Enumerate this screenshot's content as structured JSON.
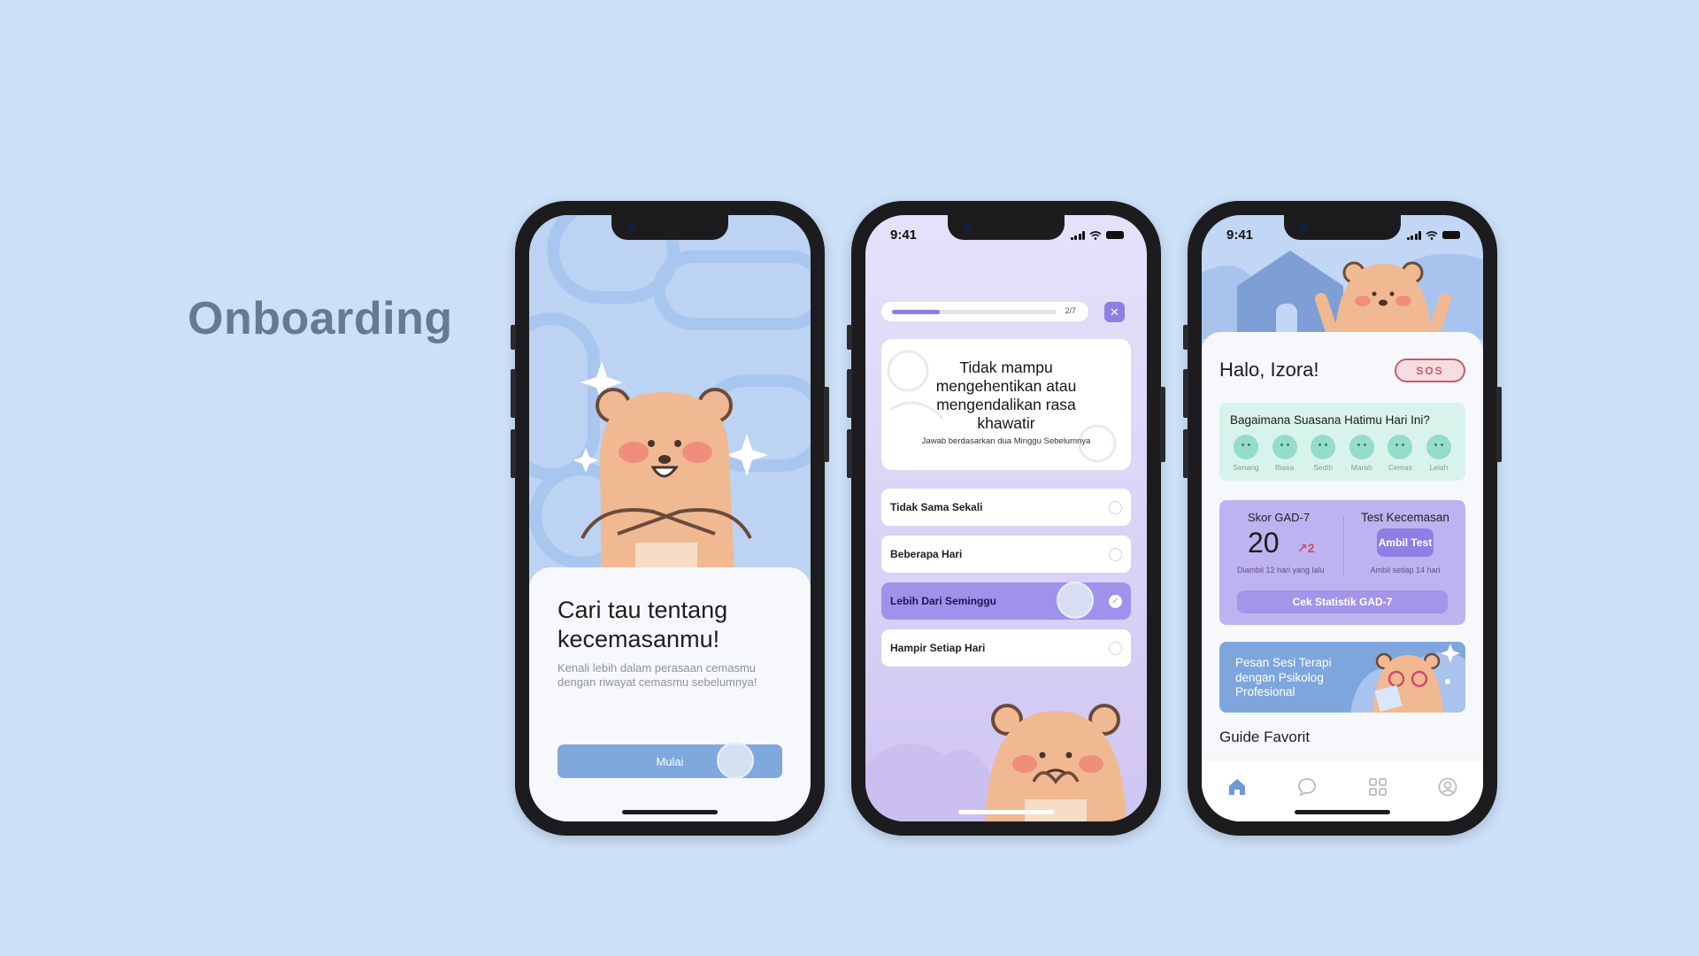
{
  "page": {
    "heading": "Onboarding"
  },
  "onboarding": {
    "title_line1": "Cari tau tentang",
    "title_line2": "kecemasanmu!",
    "subtitle_line1": "Kenali lebih dalam perasaan cemasmu",
    "subtitle_line2": "dengan riwayat cemasmu sebelumnya!",
    "start_button": "Mulai"
  },
  "questionnaire": {
    "time": "9:41",
    "progress_label": "2/7",
    "progress_fraction": 0.29,
    "close_icon": "✕",
    "question_lines": [
      "Tidak mampu",
      "mengehentikan atau",
      "mengendalikan rasa",
      "khawatir"
    ],
    "instruction": "Jawab berdasarkan dua Minggu Sebelumnya",
    "options": [
      {
        "label": "Tidak Sama Sekali",
        "selected": false
      },
      {
        "label": "Beberapa Hari",
        "selected": false
      },
      {
        "label": "Lebih Dari Seminggu",
        "selected": true
      },
      {
        "label": "Hampir Setiap Hari",
        "selected": false
      }
    ],
    "check_mark": "✓"
  },
  "home": {
    "time": "9:41",
    "greeting": "Halo, Izora!",
    "sos": "SOS",
    "mood_title": "Bagaimana Suasana Hatimu Hari Ini?",
    "moods": [
      "Senang",
      "Biasa",
      "Sedih",
      "Marah",
      "Cemas",
      "Lelah"
    ],
    "gad_title": "Skor GAD-7",
    "gad_score": "20",
    "gad_delta": "↗2",
    "gad_taken": "Diambil 12 hari yang lalu",
    "test_title": "Test Kecemasan",
    "test_button": "Ambil Test",
    "test_every": "Ambil setiap 14 hari",
    "stats_button": "Cek Statistik GAD-7",
    "therapy_text": "Pesan Sesi Terapi dengan Psikolog Profesional",
    "guide_title": "Guide Favorit",
    "tabs": [
      "home-icon",
      "chat-icon",
      "grid-icon",
      "profile-icon"
    ]
  },
  "colors": {
    "background": "#cde0f9",
    "accent_purple": "#8f7fe4",
    "accent_blue": "#7fa8dc",
    "sos_red": "#c95b6b",
    "mood_green": "#d8f3eb"
  }
}
